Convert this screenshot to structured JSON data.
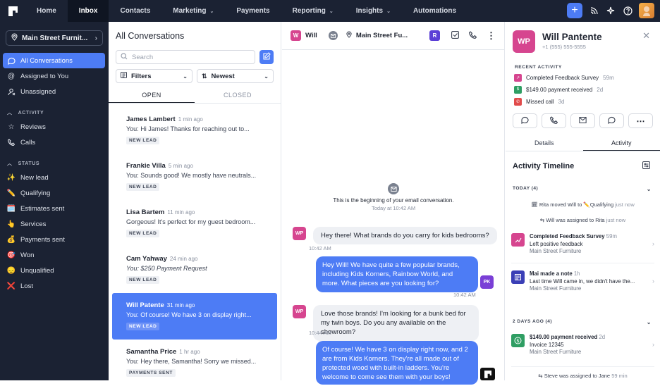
{
  "nav": {
    "items": [
      {
        "label": "Home",
        "dropdown": false
      },
      {
        "label": "Inbox",
        "dropdown": false,
        "active": true
      },
      {
        "label": "Contacts",
        "dropdown": false
      },
      {
        "label": "Marketing",
        "dropdown": true
      },
      {
        "label": "Payments",
        "dropdown": false
      },
      {
        "label": "Reporting",
        "dropdown": true
      },
      {
        "label": "Insights",
        "dropdown": true
      },
      {
        "label": "Automations",
        "dropdown": false
      }
    ],
    "accent": "#4d7cf5"
  },
  "sidebar": {
    "location": "Main Street Furnit...",
    "main_items": [
      "All Conversations",
      "Assigned to You",
      "Unassigned"
    ],
    "activity_header": "ACTIVITY",
    "activity_items": [
      "Reviews",
      "Calls"
    ],
    "status_header": "STATUS",
    "status_items": [
      {
        "emoji": "✨",
        "label": "New lead"
      },
      {
        "emoji": "✏️",
        "label": "Qualifying"
      },
      {
        "emoji": "🗓️",
        "label": "Estimates sent"
      },
      {
        "emoji": "👆",
        "label": "Services"
      },
      {
        "emoji": "💰",
        "label": "Payments sent"
      },
      {
        "emoji": "🎯",
        "label": "Won"
      },
      {
        "emoji": "😞",
        "label": "Unqualified"
      },
      {
        "emoji": "❌",
        "label": "Lost"
      }
    ]
  },
  "conversations": {
    "title": "All Conversations",
    "search_placeholder": "Search",
    "filter_label": "Filters",
    "sort_label": "Newest",
    "tab_open": "OPEN",
    "tab_closed": "CLOSED",
    "items": [
      {
        "name": "James Lambert",
        "time": "1 min ago",
        "preview": "You: Hi James! Thanks for reaching out to...",
        "italic": false,
        "tag": "NEW LEAD"
      },
      {
        "name": "Frankie Villa",
        "time": "5 min ago",
        "preview": "You: Sounds good! We mostly have neutrals...",
        "italic": false,
        "tag": "NEW LEAD"
      },
      {
        "name": "Lisa Bartem",
        "time": "11 min ago",
        "preview": "Gorgeous! It's perfect for my guest bedroom...",
        "italic": false,
        "tag": "NEW LEAD"
      },
      {
        "name": "Cam Yahway",
        "time": "24 min ago",
        "preview": "You: $250 Payment Request",
        "italic": true,
        "tag": "NEW LEAD"
      },
      {
        "name": "Will Patente",
        "time": "31 min ago",
        "preview": "You: Of course! We have 3 on display right...",
        "italic": false,
        "tag": "NEW LEAD",
        "active": true
      },
      {
        "name": "Samantha Price",
        "time": "1 hr ago",
        "preview": "You: Hey there, Samantha! Sorry we missed...",
        "italic": false,
        "tag": "PAYMENTS SENT"
      }
    ]
  },
  "chat": {
    "contact": "Will",
    "contact_initial": "W",
    "location": "Main Street Fu...",
    "assignee_initial": "R",
    "begin_text": "This is the beginning of your email conversation.",
    "begin_time": "Today at 10:42 AM",
    "messages": [
      {
        "dir": "in",
        "avatar": "WP",
        "text": "Hey there! What brands do you carry for kids bedrooms?",
        "time": "10:42 AM"
      },
      {
        "dir": "out",
        "avatar": "PK",
        "text": "Hey Will! We have quite a few popular brands, including Kids Korners, Rainbow World, and more. What pieces are you looking for?",
        "time": "10:42 AM"
      },
      {
        "dir": "in",
        "avatar": "WP",
        "text": "Love those brands! I'm looking for a bunk bed for my twin boys. Do you any available on the showroom?",
        "time": "10:44 AM"
      },
      {
        "dir": "out",
        "avatar": "",
        "text": "Of course! We have 3 on display right now, and 2 are from Kids Korners. They're all made out of protected wood with built-in ladders. You're welcome to come see them with your boys!",
        "time": ""
      }
    ]
  },
  "panel": {
    "initials": "WP",
    "name": "Will Pantente",
    "phone": "+1 (555) 555-5555",
    "recent_header": "RECENT ACTIVITY",
    "recent": [
      {
        "label": "Completed Feedback Survey",
        "time": "59m",
        "color": "#d6458f"
      },
      {
        "label": "$149.00 payment received",
        "time": "2d",
        "color": "#2f9e63"
      },
      {
        "label": "Missed call",
        "time": "3d",
        "color": "#e14b4b"
      }
    ],
    "tab_details": "Details",
    "tab_activity": "Activity",
    "timeline_title": "Activity Timeline",
    "day1": "TODAY (4)",
    "sys1": "Rita moved Will to",
    "sys1_emoji": "✏️",
    "sys1_status": "Qualifying",
    "sys1_time": "just now",
    "sys2": "Will was assigned to Rita",
    "sys2_time": "just now",
    "ev1": {
      "title": "Completed Feedback Survey",
      "time": "59m",
      "line2": "Left positive feedback",
      "line3": "Main Street Furniture"
    },
    "ev2": {
      "title": "Mai made a note",
      "time": "1h",
      "line2": "Last time Will came in, we didn't have the...",
      "line3": "Main Street Furniture"
    },
    "day2": "2 DAYS AGO (4)",
    "ev3": {
      "title": "$149.00 payment received",
      "time": "2d",
      "line2": "Invoice 12345",
      "line3": "Main Street Furniture"
    },
    "sys3": "Steve was assigned to Jane",
    "sys3_time": "59 min"
  }
}
